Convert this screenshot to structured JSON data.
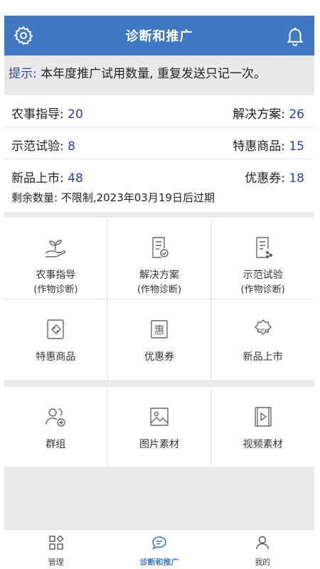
{
  "header": {
    "title": "诊断和推广",
    "left_icon": "gear-icon",
    "right_icon": "bell-icon"
  },
  "notice": {
    "label": "提示:",
    "text": " 本年度推广试用数量, 重复发送只记一次。"
  },
  "stats": [
    {
      "left_label": "农事指导:",
      "left_value": "20",
      "right_label": "解决方案:",
      "right_value": "26"
    },
    {
      "left_label": "示范试验:",
      "left_value": "8",
      "right_label": "特惠商品:",
      "right_value": "15"
    },
    {
      "left_label": "新品上市:",
      "left_value": "48",
      "right_label": "优惠券:",
      "right_value": "18"
    }
  ],
  "remain": "剩余数量: 不限制,2023年03月19日后过期",
  "grid1": [
    {
      "label": "农事指导",
      "sub": "(作物诊断)",
      "icon": "hand-plant-icon"
    },
    {
      "label": "解决方案",
      "sub": "(作物诊断)",
      "icon": "document-check-icon"
    },
    {
      "label": "示范试验",
      "sub": "(作物诊断)",
      "icon": "document-chart-icon"
    },
    {
      "label": "特惠商品",
      "sub": "",
      "icon": "discount-tag-icon"
    },
    {
      "label": "优惠券",
      "sub": "",
      "icon": "coupon-icon"
    },
    {
      "label": "新品上市",
      "sub": "",
      "icon": "new-badge-icon"
    }
  ],
  "grid2": [
    {
      "label": "群组",
      "icon": "group-add-icon"
    },
    {
      "label": "图片素材",
      "icon": "image-icon"
    },
    {
      "label": "视频素材",
      "icon": "video-icon"
    }
  ],
  "tabs": [
    {
      "label": "管理",
      "icon": "grid-icon"
    },
    {
      "label": "诊断和推广",
      "icon": "chat-icon"
    },
    {
      "label": "我的",
      "icon": "user-icon"
    }
  ],
  "colors": {
    "header": "#3f79c3",
    "number": "#2f3f9e",
    "notice_label": "#2f49a6"
  }
}
